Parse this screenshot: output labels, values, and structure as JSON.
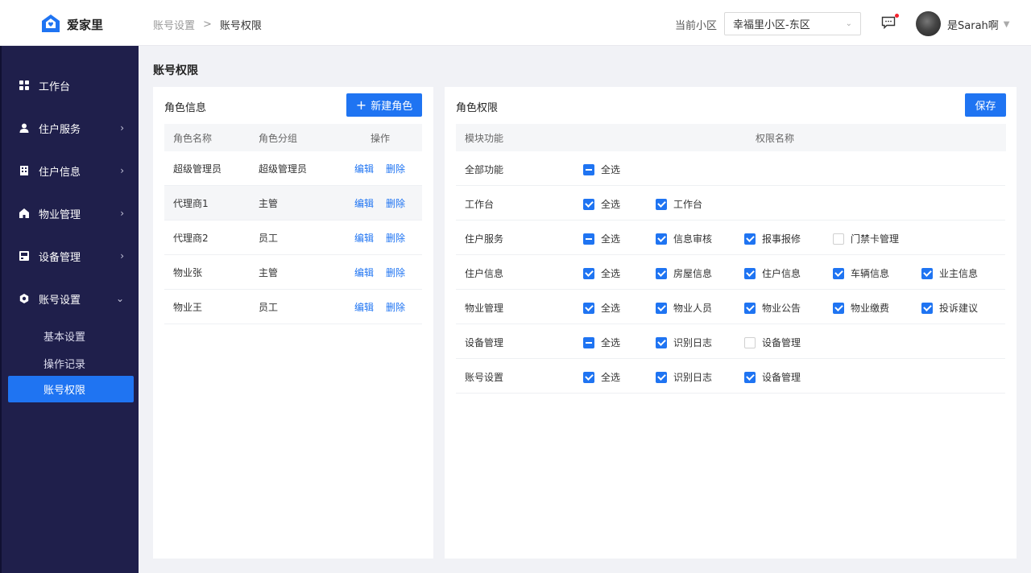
{
  "app": {
    "name": "爱家里"
  },
  "breadcrumb": {
    "parent": "账号设置",
    "separator": ">",
    "current": "账号权限"
  },
  "header": {
    "community_label": "当前小区",
    "community_value": "幸福里小区-东区",
    "user_name": "是Sarah啊"
  },
  "sidebar": {
    "items": [
      {
        "label": "工作台",
        "icon": "dashboard-icon"
      },
      {
        "label": "住户服务",
        "icon": "user-icon"
      },
      {
        "label": "住户信息",
        "icon": "building-icon"
      },
      {
        "label": "物业管理",
        "icon": "home-icon"
      },
      {
        "label": "设备管理",
        "icon": "device-icon"
      },
      {
        "label": "账号设置",
        "icon": "settings-icon"
      }
    ],
    "sub_items": [
      "基本设置",
      "操作记录",
      "账号权限"
    ]
  },
  "page": {
    "title": "账号权限"
  },
  "roles": {
    "title": "角色信息",
    "new_button": "新建角色",
    "columns": [
      "角色名称",
      "角色分组",
      "操作"
    ],
    "actions": {
      "edit": "编辑",
      "delete": "删除"
    },
    "rows": [
      {
        "name": "超级管理员",
        "group": "超级管理员"
      },
      {
        "name": "代理商1",
        "group": "主管"
      },
      {
        "name": "代理商2",
        "group": "员工"
      },
      {
        "name": "物业张",
        "group": "主管"
      },
      {
        "name": "物业王",
        "group": "员工"
      }
    ]
  },
  "permissions": {
    "title": "角色权限",
    "save_button": "保存",
    "columns": [
      "模块功能",
      "权限名称"
    ],
    "rows": [
      {
        "module": "全部功能",
        "items": [
          {
            "label": "全选",
            "state": "indeterminate"
          }
        ]
      },
      {
        "module": "工作台",
        "items": [
          {
            "label": "全选",
            "state": "checked"
          },
          {
            "label": "工作台",
            "state": "checked"
          }
        ]
      },
      {
        "module": "住户服务",
        "items": [
          {
            "label": "全选",
            "state": "indeterminate"
          },
          {
            "label": "信息审核",
            "state": "checked"
          },
          {
            "label": "报事报修",
            "state": "checked"
          },
          {
            "label": "门禁卡管理",
            "state": "unchecked"
          }
        ]
      },
      {
        "module": "住户信息",
        "items": [
          {
            "label": "全选",
            "state": "checked"
          },
          {
            "label": "房屋信息",
            "state": "checked"
          },
          {
            "label": "住户信息",
            "state": "checked"
          },
          {
            "label": "车辆信息",
            "state": "checked"
          },
          {
            "label": "业主信息",
            "state": "checked"
          }
        ]
      },
      {
        "module": "物业管理",
        "items": [
          {
            "label": "全选",
            "state": "checked"
          },
          {
            "label": "物业人员",
            "state": "checked"
          },
          {
            "label": "物业公告",
            "state": "checked"
          },
          {
            "label": "物业缴费",
            "state": "checked"
          },
          {
            "label": "投诉建议",
            "state": "checked"
          }
        ]
      },
      {
        "module": "设备管理",
        "items": [
          {
            "label": "全选",
            "state": "indeterminate"
          },
          {
            "label": "识别日志",
            "state": "checked"
          },
          {
            "label": "设备管理",
            "state": "unchecked"
          }
        ]
      },
      {
        "module": "账号设置",
        "items": [
          {
            "label": "全选",
            "state": "checked"
          },
          {
            "label": "识别日志",
            "state": "checked"
          },
          {
            "label": "设备管理",
            "state": "checked"
          }
        ]
      }
    ]
  },
  "colors": {
    "primary": "#1f74f2",
    "sidebar": "#1f1f4b",
    "notification": "#f5222d"
  }
}
